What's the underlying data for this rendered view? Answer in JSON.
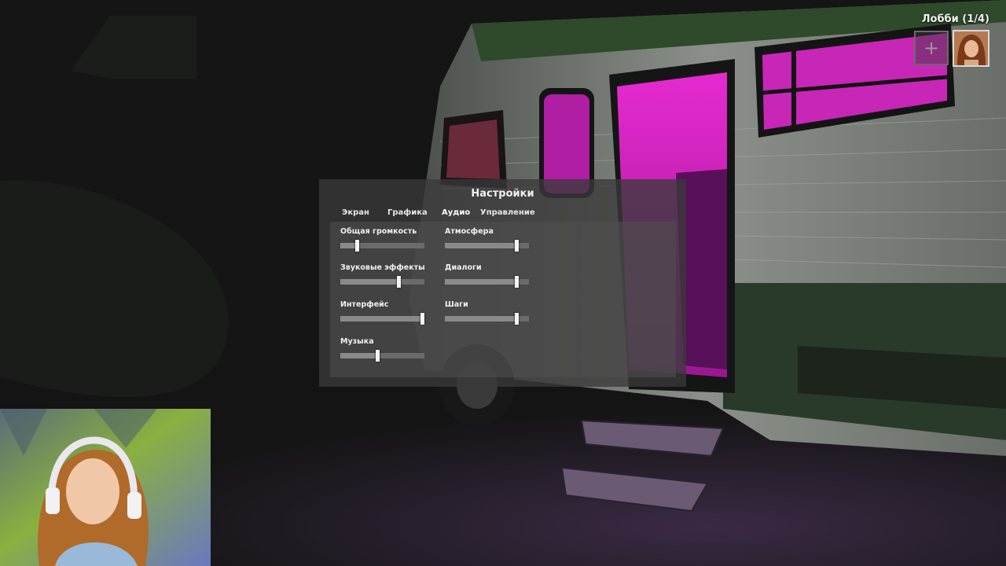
{
  "lobby": {
    "label": "Лобби (1/4)",
    "add_slot": "+"
  },
  "settings": {
    "title": "Настройки",
    "tabs": [
      {
        "label": "Экран"
      },
      {
        "label": "Графика"
      },
      {
        "label": "Аудио"
      },
      {
        "label": "Управление"
      }
    ],
    "active_tab": "Аудио",
    "sliders": [
      {
        "label": "Общая громкость",
        "level": 0.2
      },
      {
        "label": "Звуковые эффекты",
        "level": 0.69
      },
      {
        "label": "Интерфейс",
        "level": 0.97
      },
      {
        "label": "Музыка",
        "level": 0.44
      },
      {
        "label": "Атмосфера",
        "level": 0.85
      },
      {
        "label": "Диалоги",
        "level": 0.85
      },
      {
        "label": "Шаги",
        "level": 0.85
      }
    ]
  },
  "colors": {
    "rv_interior_light": "#e020c8",
    "rv_body": "#c9ccc6",
    "panel_bg": "#3a3a3a"
  }
}
